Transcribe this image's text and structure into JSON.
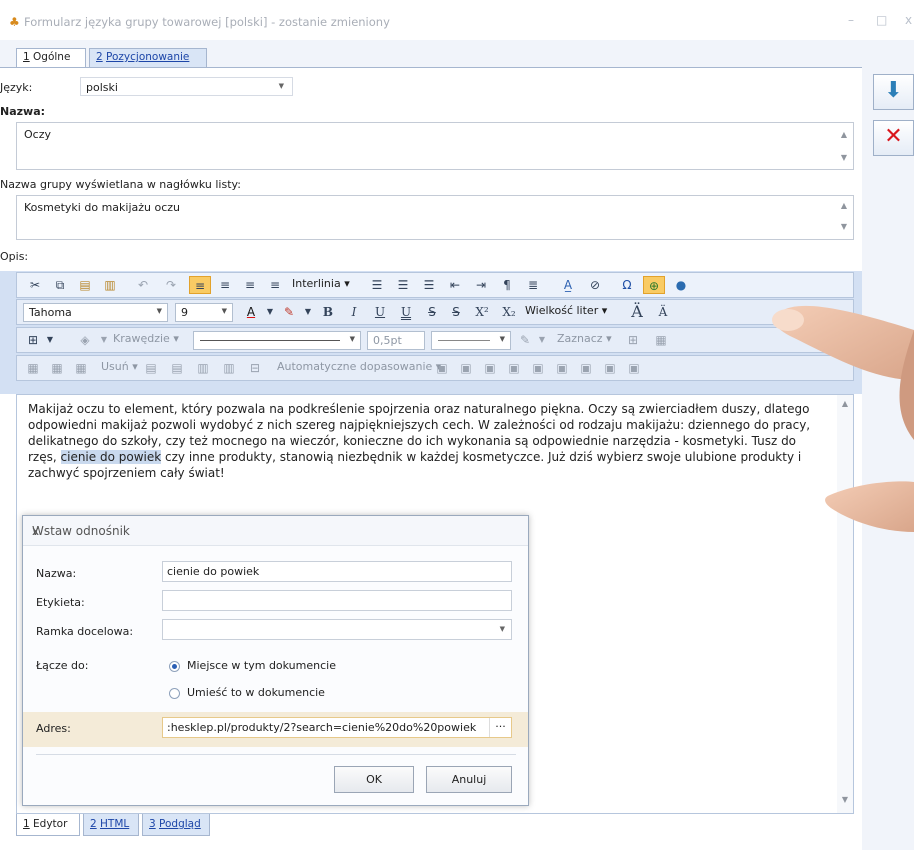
{
  "window": {
    "title": "Formularz języka grupy towarowej [polski] - zostanie zmieniony",
    "controls": [
      "–",
      "□",
      "x"
    ]
  },
  "tabs": [
    {
      "num": "1",
      "label": "Ogólne",
      "active": true
    },
    {
      "num": "2",
      "label": "Pozycjonowanie",
      "active": false
    }
  ],
  "form": {
    "language_label": "Język:",
    "language_value": "polski",
    "name_label": "Nazwa:",
    "name_value": "Oczy",
    "header_label": "Nazwa grupy wyświetlana w nagłówku listy:",
    "header_value": "Kosmetyki do makijażu oczu",
    "desc_label": "Opis:"
  },
  "toolbar": {
    "interlinia": "Interlinia",
    "font": "Tahoma",
    "size": "9",
    "wielkosc": "Wielkość liter",
    "krawedzie": "Krawędzie",
    "border_width": "0,5pt",
    "zaznacz": "Zaznacz",
    "usun": "Usuń",
    "auto": "Automatyczne dopasowanie",
    "b": "B",
    "i": "I",
    "u": "U",
    "x2": "X²",
    "xsub": "X₂",
    "A": "A",
    "omega": "Ω",
    "para": "¶"
  },
  "editor": {
    "text_before": "Makijaż oczu to element, który pozwala na podkreślenie spojrzenia oraz naturalnego piękna. Oczy są zwierciadłem duszy, dlatego odpowiedni makijaż pozwoli wydobyć z nich szereg najpiękniejszych cech. W zależności od rodzaju makijażu: dziennego do pracy, delikatnego do szkoły, czy też mocnego na wieczór, konieczne do ich wykonania są odpowiednie narzędzia - kosmetyki. Tusz do rzęs,",
    "selected": "cienie do powiek",
    "text_after": "czy inne produkty, stanowią niezbędnik w każdej kosmetyczce. Już dziś wybierz swoje ulubione produkty i zachwyć spojrzeniem cały świat!"
  },
  "dialog": {
    "title": "Wstaw odnośnik",
    "close": "x",
    "nazwa_label": "Nazwa:",
    "nazwa_value": "cienie do powiek",
    "etykieta_label": "Etykieta:",
    "etykieta_value": "",
    "ramka_label": "Ramka docelowa:",
    "ramka_value": "",
    "lacze_label": "Łącze do:",
    "radio1": "Miejsce w tym dokumencie",
    "radio2": "Umieść to w dokumencie",
    "adres_label": "Adres:",
    "adres_value": ":hesklep.pl/produkty/2?search=cienie%20do%20powiek",
    "ellipsis": "···",
    "ok": "OK",
    "cancel": "Anuluj"
  },
  "bottom_tabs": [
    {
      "num": "1",
      "label": "Edytor",
      "active": true
    },
    {
      "num": "2",
      "label": "HTML",
      "active": false
    },
    {
      "num": "3",
      "label": "Podgląd",
      "active": false
    }
  ],
  "colors": {
    "save": "#2c7fb8",
    "cancel": "#d9161c",
    "selection": "#c9d9ee",
    "highlight": "#f9cb64"
  }
}
